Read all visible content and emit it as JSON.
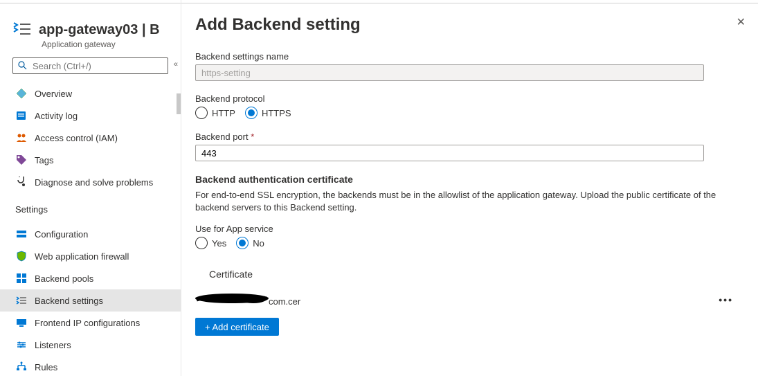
{
  "header": {
    "breadcrumb": "app-gateway03 | B",
    "subtitle": "Application gateway",
    "search_placeholder": "Search (Ctrl+/)"
  },
  "nav": {
    "top": [
      {
        "label": "Overview",
        "icon": "overview"
      },
      {
        "label": "Activity log",
        "icon": "activity"
      },
      {
        "label": "Access control (IAM)",
        "icon": "iam"
      },
      {
        "label": "Tags",
        "icon": "tags"
      },
      {
        "label": "Diagnose and solve problems",
        "icon": "diagnose"
      }
    ],
    "settings_header": "Settings",
    "settings": [
      {
        "label": "Configuration",
        "icon": "config"
      },
      {
        "label": "Web application firewall",
        "icon": "waf"
      },
      {
        "label": "Backend pools",
        "icon": "bpool"
      },
      {
        "label": "Backend settings",
        "icon": "bsettings",
        "active": true
      },
      {
        "label": "Frontend IP configurations",
        "icon": "frontend"
      },
      {
        "label": "Listeners",
        "icon": "listen"
      },
      {
        "label": "Rules",
        "icon": "rules"
      }
    ]
  },
  "panel": {
    "title": "Add Backend setting",
    "name_label": "Backend settings name",
    "name_value": "https-setting",
    "protocol_label": "Backend protocol",
    "protocol_options": {
      "http": "HTTP",
      "https": "HTTPS"
    },
    "protocol_selected": "HTTPS",
    "port_label": "Backend port",
    "port_value": "443",
    "auth_header": "Backend authentication certificate",
    "auth_desc": "For end-to-end SSL encryption, the backends must be in the allowlist of the application gateway. Upload the public certificate of the backend servers to this Backend setting.",
    "appsvc_label": "Use for App service",
    "appsvc_options": {
      "yes": "Yes",
      "no": "No"
    },
    "appsvc_selected": "No",
    "cert_header": "Certificate",
    "cert_file_suffix": "com.cer",
    "add_cert_label": "+ Add certificate"
  }
}
